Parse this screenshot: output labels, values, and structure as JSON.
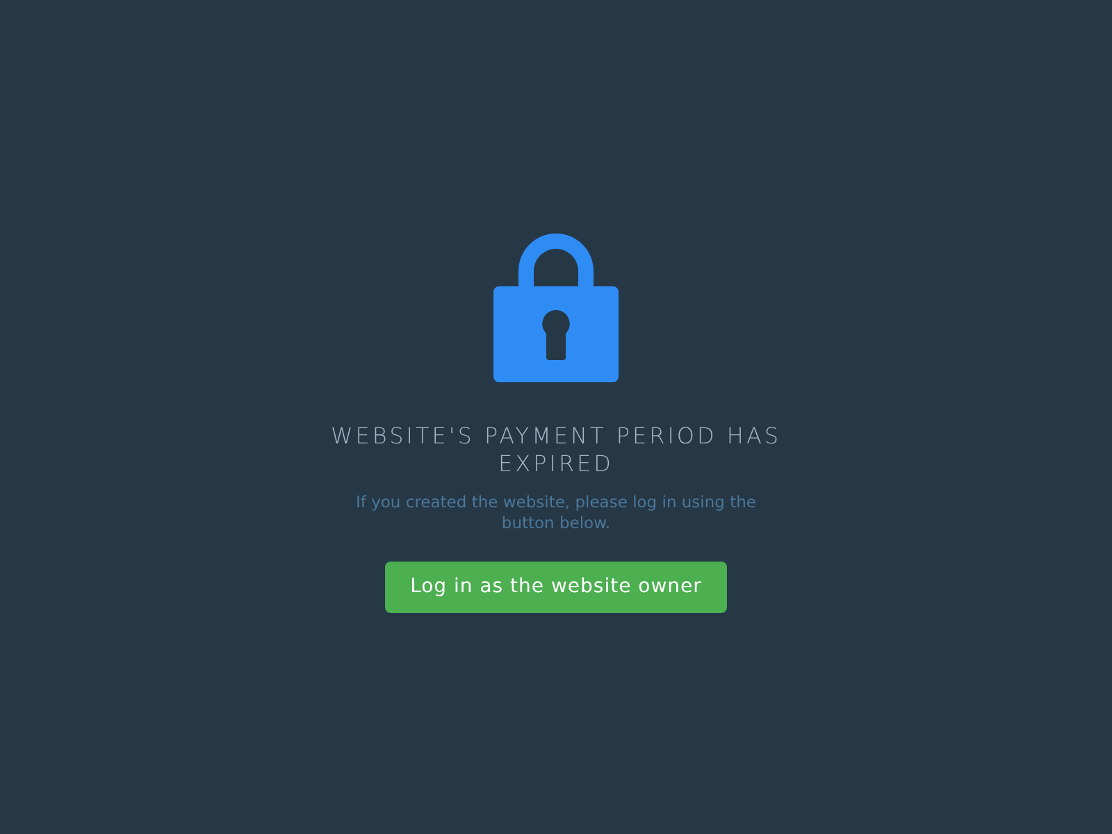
{
  "title": "WEBSITE'S PAYMENT PERIOD HAS EXPIRED",
  "message": "If you created the website, please log in using the button below.",
  "button": {
    "label": "Log in as the website owner"
  }
}
